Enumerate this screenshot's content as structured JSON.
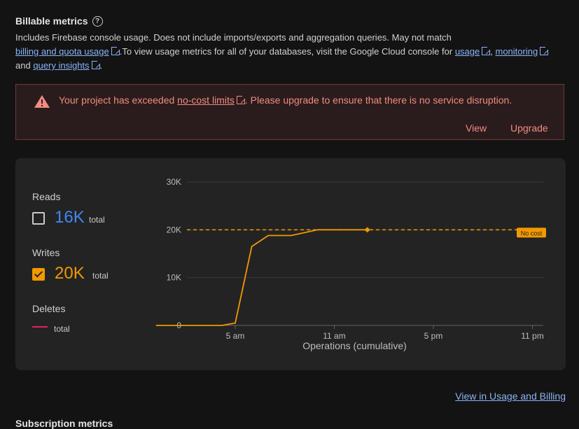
{
  "header": {
    "title": "Billable metrics",
    "desc_line1": "Includes Firebase console usage. Does not include imports/exports and aggregation queries. May not match",
    "link_billing": "billing and quota usage",
    "desc_mid": ".To view usage metrics for all of your databases, visit the Google Cloud console for",
    "link_usage": "usage",
    "sep_comma": ",",
    "link_monitoring": "monitoring",
    "and": "and",
    "link_insights": "query insights",
    "period": "."
  },
  "alert": {
    "text_before": "Your project has exceeded",
    "link": "no-cost limits",
    "text_after": ". Please upgrade to ensure that there is no service disruption.",
    "view_btn": "View",
    "upgrade_btn": "Upgrade"
  },
  "metrics": {
    "reads": {
      "label": "Reads",
      "value": "16K",
      "total": "total",
      "checked": false,
      "color": "#4285f4"
    },
    "writes": {
      "label": "Writes",
      "value": "20K",
      "total": "total",
      "checked": true,
      "color": "#f29900"
    },
    "deletes": {
      "label": "Deletes",
      "total": "total",
      "color": "#e91e63"
    }
  },
  "chart_data": {
    "type": "line",
    "xlabel": "Operations (cumulative)",
    "x_ticks": [
      "5 am",
      "11 am",
      "5 pm",
      "11 pm"
    ],
    "y_ticks": [
      "0",
      "10K",
      "20K",
      "30K"
    ],
    "ylim": [
      0,
      30000
    ],
    "series": [
      {
        "name": "Writes",
        "color": "#f29900",
        "x_hours": [
          0,
          4,
          4.8,
          5.8,
          6.8,
          8.2,
          9.8,
          12.8
        ],
        "values": [
          0,
          0,
          500,
          16500,
          18800,
          18800,
          20000,
          20000
        ]
      }
    ],
    "threshold": {
      "value": 20000,
      "label": "No cost",
      "color": "#f29900"
    }
  },
  "footer": {
    "usage_link": "View in Usage and Billing",
    "next_section": "Subscription metrics"
  }
}
